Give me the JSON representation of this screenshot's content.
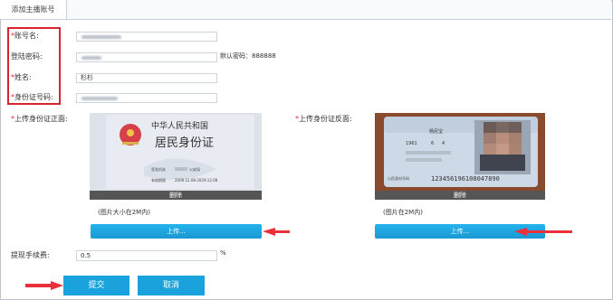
{
  "tab": {
    "label": "添加主播账号"
  },
  "form": {
    "required_mark": "*",
    "account_label": "账号名:",
    "password_label": "登陆密码:",
    "password_hint": "默认密码：888888",
    "name_label": "姓名:",
    "name_value": "杉杉",
    "idnum_label": "身份证号码:",
    "front_label": "上传身份证正面:",
    "back_label": "上传身份证反面:",
    "delete_label": "删除",
    "front_hint": "(图片大小在2M内)",
    "back_hint": "(图片在2M内)",
    "upload_label": "上传...",
    "fee_label": "提现手续费:",
    "fee_value": "0.5",
    "fee_unit": "%"
  },
  "idcard_front": {
    "title": "中华人民共和国",
    "subtitle": "居民身份证",
    "issuer_label": "签发机关",
    "issuer_suffix": "公安局",
    "valid_label": "有效期限",
    "valid_value": "2009.12.08-2029.12.08"
  },
  "idcard_back": {
    "name": "杨尼宝",
    "birth_year": "1961",
    "birth_month": "6",
    "birth_day": "4",
    "number_label": "公民身份号码",
    "number": "123456196108047890"
  },
  "actions": {
    "submit": "提交",
    "cancel": "取消"
  },
  "colors": {
    "accent": "#19a2dc",
    "highlight": "#d9232f",
    "arrow": "#e8313b"
  }
}
